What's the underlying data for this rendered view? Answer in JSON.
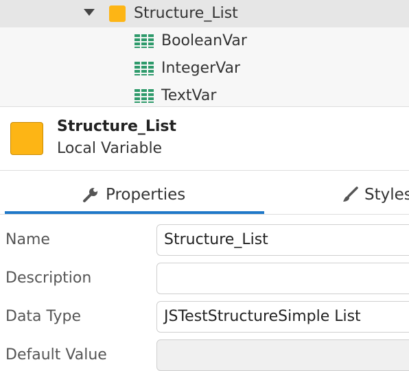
{
  "tree": {
    "parent": {
      "label": "Structure_List",
      "icon": "structure-icon",
      "color": "#fdb515"
    },
    "children": [
      {
        "label": "BooleanVar",
        "icon": "attribute-icon"
      },
      {
        "label": "IntegerVar",
        "icon": "attribute-icon"
      },
      {
        "label": "TextVar",
        "icon": "attribute-icon"
      }
    ]
  },
  "summary": {
    "title": "Structure_List",
    "subtitle": "Local Variable"
  },
  "tabs": [
    {
      "label": "Properties",
      "icon": "wrench-icon",
      "active": true
    },
    {
      "label": "Styles",
      "icon": "brush-icon",
      "active": false
    }
  ],
  "properties": [
    {
      "label": "Name",
      "value": "Structure_List",
      "disabled": false
    },
    {
      "label": "Description",
      "value": "",
      "disabled": false
    },
    {
      "label": "Data Type",
      "value": "JSTestStructureSimple List",
      "disabled": false
    },
    {
      "label": "Default Value",
      "value": "",
      "disabled": true
    }
  ],
  "colors": {
    "accent": "#1f78c8",
    "structure": "#fdb515",
    "attribute_icon": "#2e9a6b"
  }
}
